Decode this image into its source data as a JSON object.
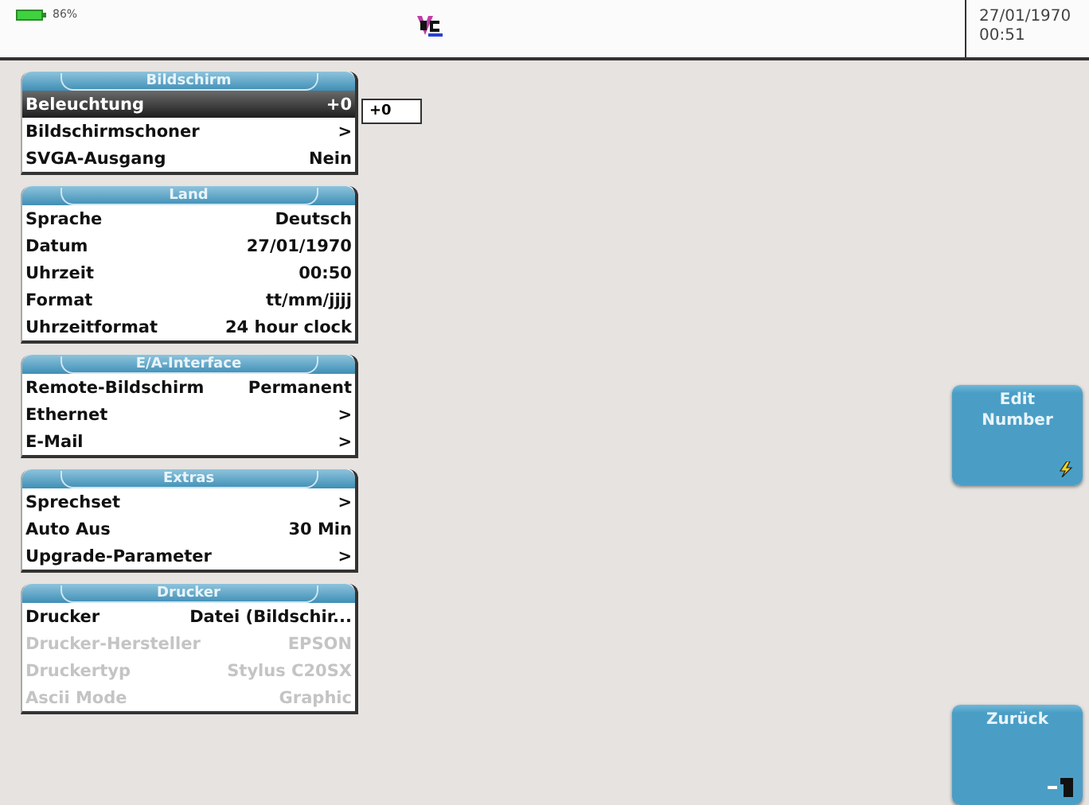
{
  "status_bar": {
    "battery": "86%",
    "date": "27/01/1970",
    "time": "00:51"
  },
  "sections": [
    {
      "title": "Bildschirm",
      "rows": [
        {
          "label": "Beleuchtung",
          "value": "+0",
          "selected": true,
          "disabled": false
        },
        {
          "label": "Bildschirmschoner",
          "value": ">",
          "selected": false,
          "disabled": false
        },
        {
          "label": "SVGA-Ausgang",
          "value": "Nein",
          "selected": false,
          "disabled": false
        }
      ]
    },
    {
      "title": "Land",
      "rows": [
        {
          "label": "Sprache",
          "value": "Deutsch",
          "selected": false,
          "disabled": false
        },
        {
          "label": "Datum",
          "value": "27/01/1970",
          "selected": false,
          "disabled": false
        },
        {
          "label": "Uhrzeit",
          "value": "00:50",
          "selected": false,
          "disabled": false
        },
        {
          "label": "Format",
          "value": "tt/mm/jjjj",
          "selected": false,
          "disabled": false
        },
        {
          "label": "Uhrzeitformat",
          "value": "24 hour clock",
          "selected": false,
          "disabled": false
        }
      ]
    },
    {
      "title": "E/A-Interface",
      "rows": [
        {
          "label": "Remote-Bildschirm",
          "value": "Permanent",
          "selected": false,
          "disabled": false
        },
        {
          "label": "Ethernet",
          "value": ">",
          "selected": false,
          "disabled": false
        },
        {
          "label": "E-Mail",
          "value": ">",
          "selected": false,
          "disabled": false
        }
      ]
    },
    {
      "title": "Extras",
      "rows": [
        {
          "label": "Sprechset",
          "value": ">",
          "selected": false,
          "disabled": false
        },
        {
          "label": "Auto Aus",
          "value": "30 Min",
          "selected": false,
          "disabled": false
        },
        {
          "label": "Upgrade-Parameter",
          "value": ">",
          "selected": false,
          "disabled": false
        }
      ]
    },
    {
      "title": "Drucker",
      "rows": [
        {
          "label": "Drucker",
          "value": "Datei (Bildschir...",
          "selected": false,
          "disabled": false
        },
        {
          "label": "Drucker-Hersteller",
          "value": "EPSON",
          "selected": false,
          "disabled": true
        },
        {
          "label": "Druckertyp",
          "value": "Stylus C20SX",
          "selected": false,
          "disabled": true
        },
        {
          "label": "Ascii Mode",
          "value": "Graphic",
          "selected": false,
          "disabled": true
        }
      ]
    }
  ],
  "edit_field": {
    "value": "+0"
  },
  "side_buttons": [
    {
      "label": "Edit\nNumber",
      "kind": "edit"
    },
    {
      "label": "Zurück",
      "kind": "back"
    }
  ]
}
